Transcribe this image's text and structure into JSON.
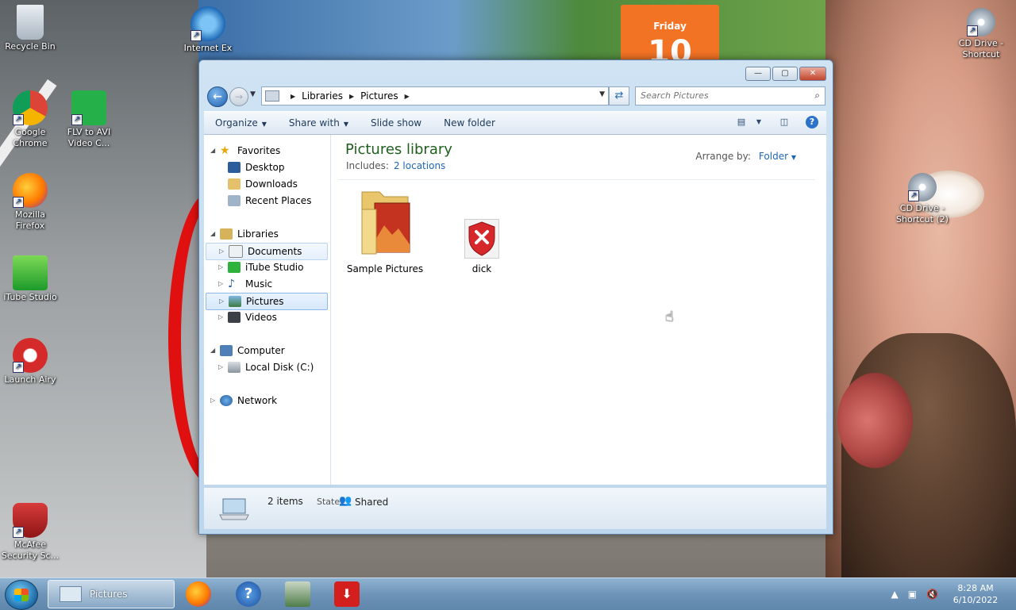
{
  "desktop": {
    "calendar_day": "Friday",
    "calendar_date": "10",
    "icons": [
      {
        "label": "Recycle Bin"
      },
      {
        "label": "Internet Ex"
      },
      {
        "label": "Google Chrome"
      },
      {
        "label": "FLV to AVI Video C..."
      },
      {
        "label": "Mozilla Firefox"
      },
      {
        "label": "iTube Studio"
      },
      {
        "label": "Launch Airy"
      },
      {
        "label": "McAfee Security Sc..."
      },
      {
        "label": "CD Drive - Shortcut"
      },
      {
        "label": "CD Drive - Shortcut (2)"
      }
    ]
  },
  "window": {
    "controls": {
      "minimize": "—",
      "maximize": "▢",
      "close": "✕"
    },
    "address": {
      "segments": [
        "Libraries",
        "Pictures"
      ]
    },
    "search": {
      "placeholder": "Search Pictures"
    },
    "toolbar": {
      "organize": "Organize",
      "share_with": "Share with",
      "slide_show": "Slide show",
      "new_folder": "New folder"
    },
    "nav": {
      "favorites": "Favorites",
      "desktop": "Desktop",
      "downloads": "Downloads",
      "recent_places": "Recent Places",
      "libraries": "Libraries",
      "documents": "Documents",
      "itube_studio": "iTube Studio",
      "music": "Music",
      "pictures": "Pictures",
      "videos": "Videos",
      "computer": "Computer",
      "local_disk": "Local Disk (C:)",
      "network": "Network"
    },
    "content": {
      "title": "Pictures library",
      "includes_label": "Includes:",
      "includes_link": "2 locations",
      "arrange_label": "Arrange by:",
      "arrange_value": "Folder",
      "items": [
        {
          "name": "Sample Pictures",
          "type": "folder"
        },
        {
          "name": "dick",
          "type": "blocked-file"
        }
      ]
    },
    "details": {
      "count": "2 items",
      "state_label": "State:",
      "state_value": "Shared"
    }
  },
  "taskbar": {
    "active_task": "Pictures",
    "time": "8:28 AM",
    "date": "6/10/2022"
  },
  "colors": {
    "library_title": "#1e5f1e",
    "link": "#1e66b5",
    "selection": "#d6e8fb"
  }
}
